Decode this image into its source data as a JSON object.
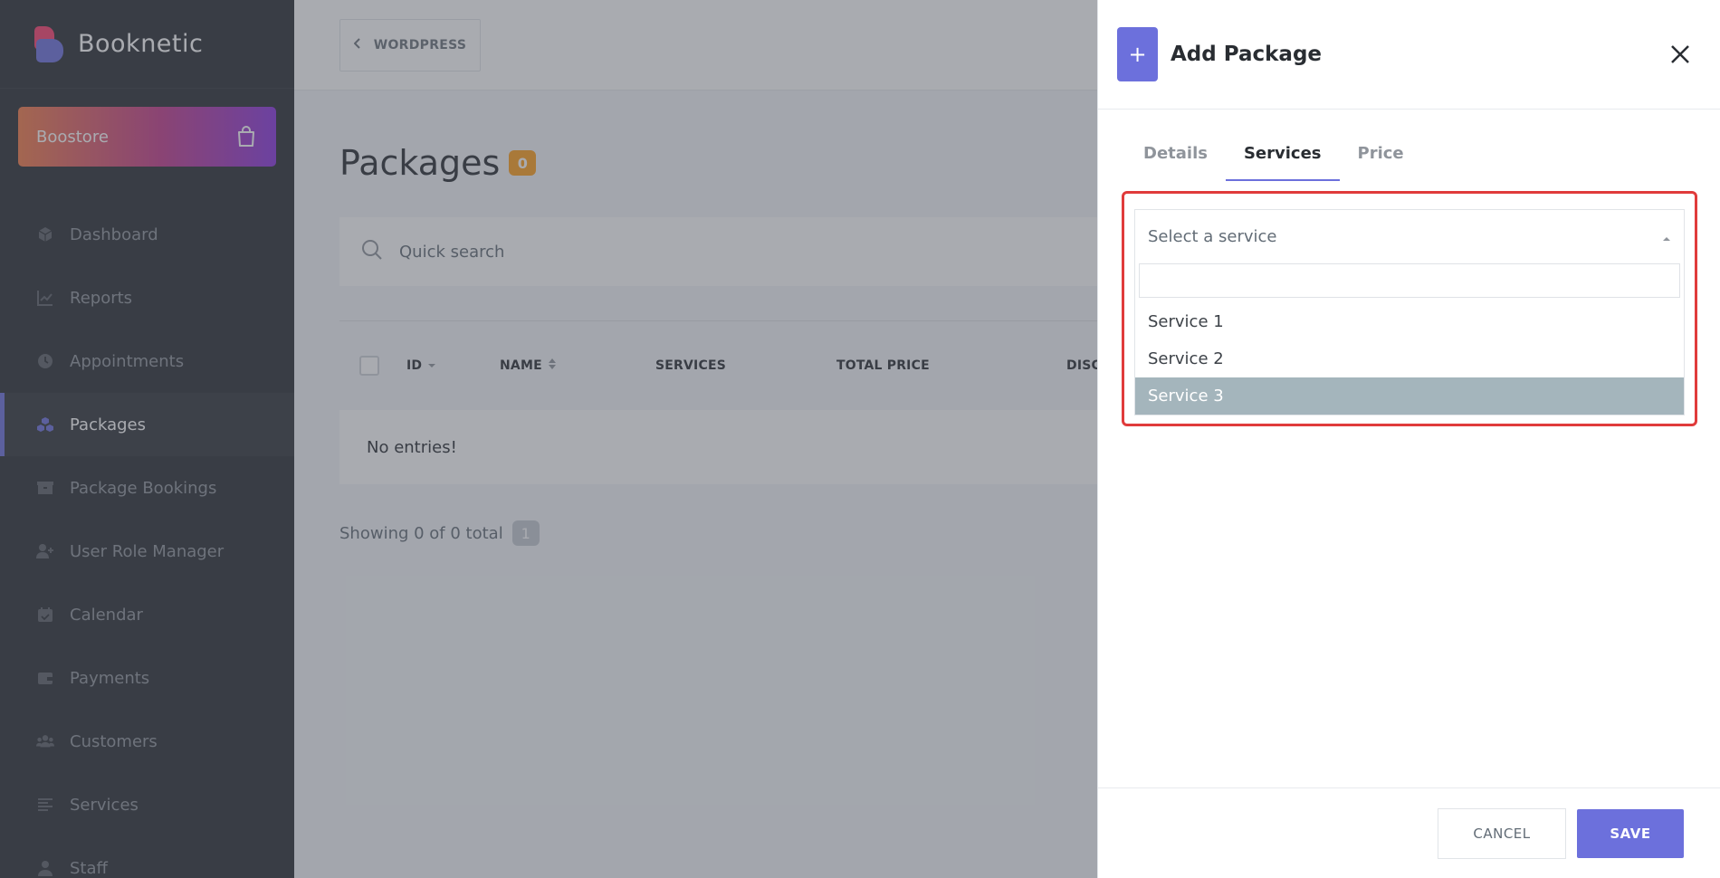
{
  "brand": {
    "name": "Booknetic"
  },
  "boostore": {
    "label": "Boostore"
  },
  "sidebar": {
    "items": [
      {
        "label": "Dashboard",
        "icon": "cube-icon"
      },
      {
        "label": "Reports",
        "icon": "chart-line-icon"
      },
      {
        "label": "Appointments",
        "icon": "clock-icon"
      },
      {
        "label": "Packages",
        "icon": "packages-icon",
        "active": true
      },
      {
        "label": "Package Bookings",
        "icon": "box-icon"
      },
      {
        "label": "User Role Manager",
        "icon": "user-plus-icon"
      },
      {
        "label": "Calendar",
        "icon": "calendar-check-icon"
      },
      {
        "label": "Payments",
        "icon": "wallet-icon"
      },
      {
        "label": "Customers",
        "icon": "users-icon"
      },
      {
        "label": "Services",
        "icon": "list-icon"
      },
      {
        "label": "Staff",
        "icon": "user-icon"
      }
    ]
  },
  "topbar": {
    "back_label": "WORDPRESS"
  },
  "page": {
    "title": "Packages",
    "count": "0"
  },
  "search": {
    "placeholder": "Quick search"
  },
  "table": {
    "columns": [
      "ID",
      "NAME",
      "SERVICES",
      "TOTAL PRICE",
      "DISC"
    ],
    "empty_text": "No entries!"
  },
  "pagination": {
    "info": "Showing 0 of 0 total",
    "current_page": "1"
  },
  "panel": {
    "title": "Add Package",
    "tabs": [
      {
        "label": "Details"
      },
      {
        "label": "Services",
        "active": true
      },
      {
        "label": "Price"
      }
    ],
    "service_select": {
      "placeholder": "Select a service",
      "options": [
        "Service 1",
        "Service 2",
        "Service 3"
      ],
      "highlighted": "Service 3"
    },
    "cancel_label": "CANCEL",
    "save_label": "SAVE"
  },
  "colors": {
    "accent": "#6c70dc",
    "sidebar_bg": "#292d32",
    "badge_orange": "#ff9f1c",
    "highlight_border": "#e03b3b",
    "option_highlight": "#a4b5bc"
  }
}
